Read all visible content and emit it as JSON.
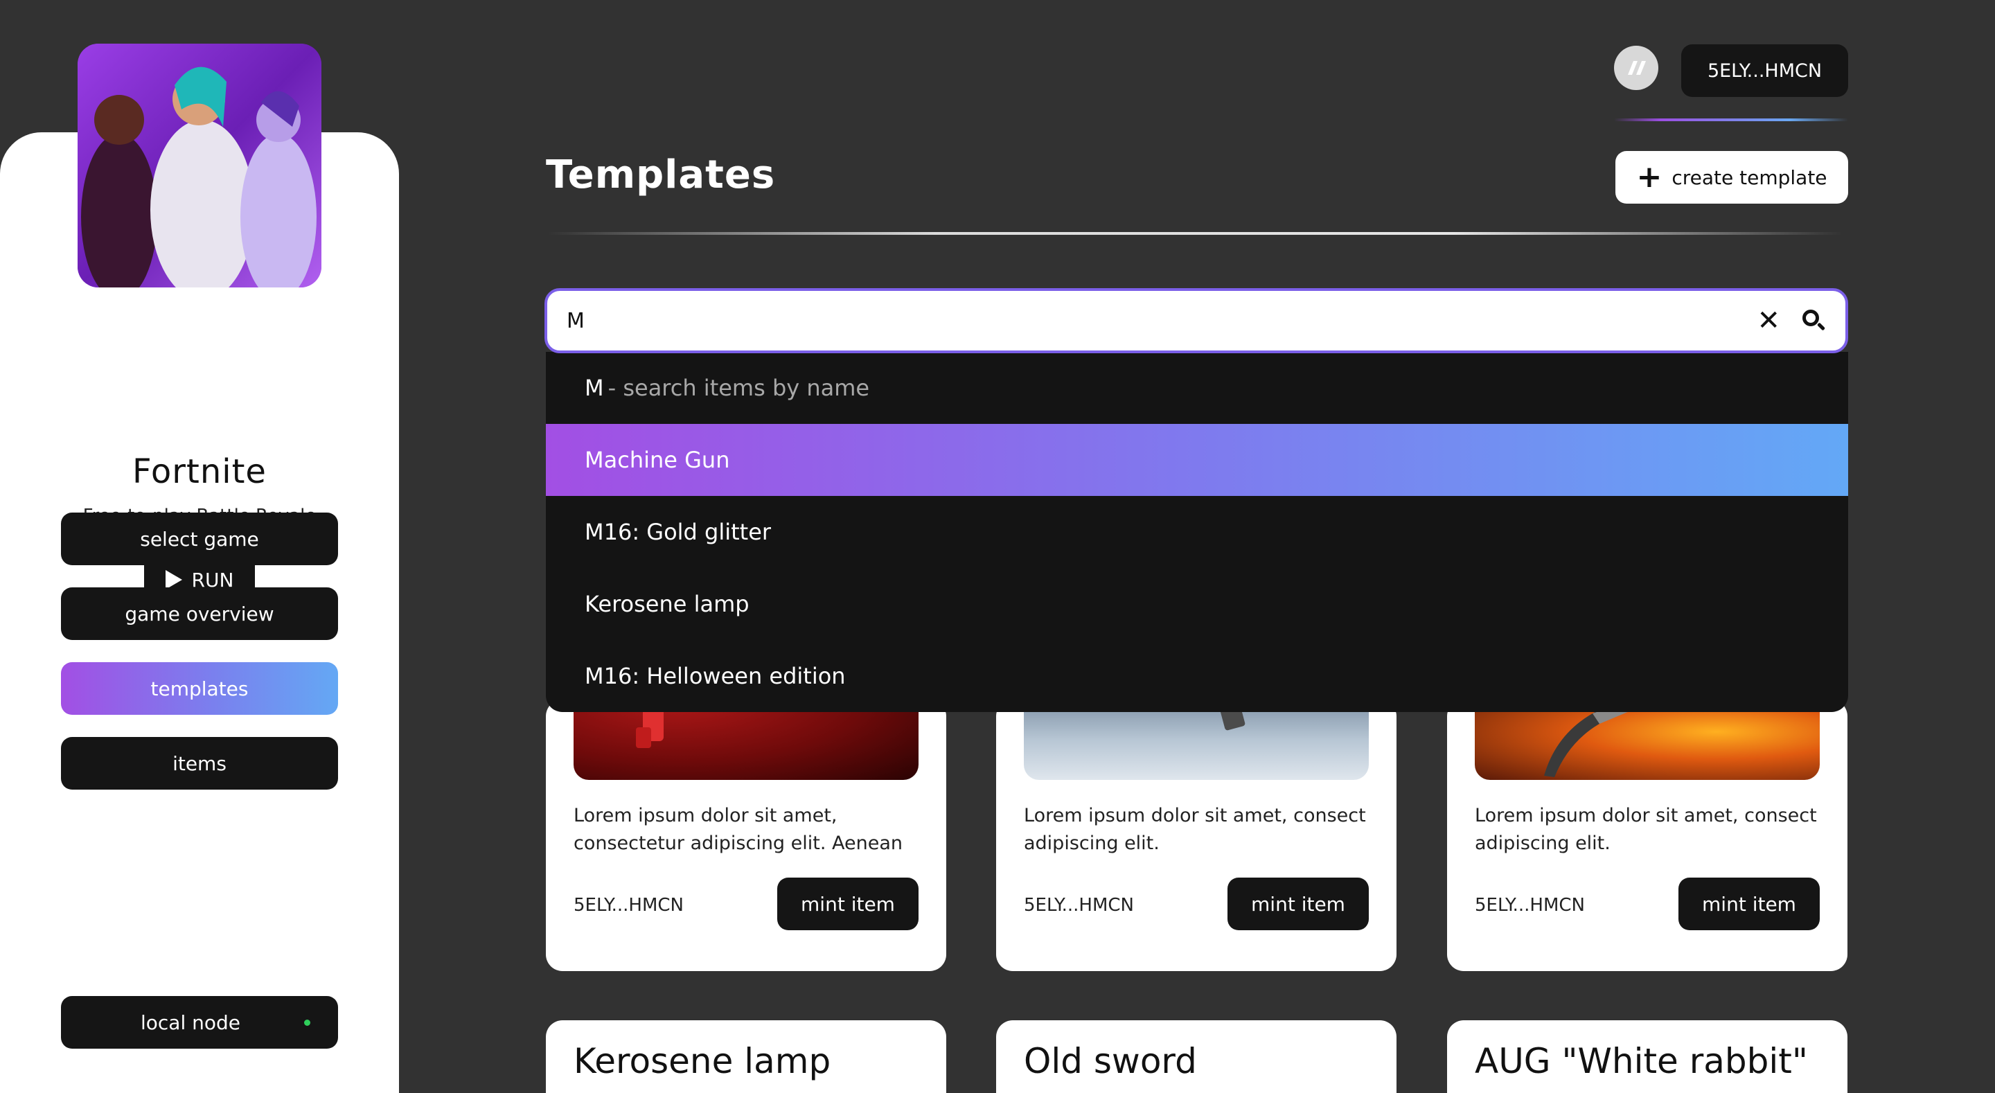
{
  "sidebar": {
    "game": {
      "title": "Fortnite",
      "subtitle": "Free-to-play Battle Royale",
      "run_label": "RUN"
    },
    "nav": [
      {
        "label": "select game",
        "active": false
      },
      {
        "label": "game overview",
        "active": false
      },
      {
        "label": "templates",
        "active": true
      },
      {
        "label": "items",
        "active": false
      }
    ],
    "node": {
      "label": "local node",
      "status_color": "#2fcf5b"
    }
  },
  "header": {
    "wallet_label": "5ELY...HMCN",
    "title": "Templates",
    "create_label": "create template"
  },
  "search": {
    "value": "M",
    "hint_query": "M",
    "hint_text": "- search items by name",
    "suggestions": [
      {
        "label": "Machine Gun",
        "selected": true
      },
      {
        "label": "M16: Gold glitter",
        "selected": false
      },
      {
        "label": "Kerosene lamp",
        "selected": false
      },
      {
        "label": "M16: Helloween edition",
        "selected": false
      }
    ]
  },
  "cards": [
    {
      "description": "Lorem ipsum dolor sit amet, consectetur adipiscing elit. Aenean v…",
      "owner": "5ELY...HMCN",
      "mint_label": "mint item"
    },
    {
      "description": "Lorem ipsum dolor sit amet, consect adipiscing elit.",
      "owner": "5ELY...HMCN",
      "mint_label": "mint item"
    },
    {
      "description": "Lorem ipsum dolor sit amet, consect adipiscing elit.",
      "owner": "5ELY...HMCN",
      "mint_label": "mint item"
    }
  ],
  "bottom_cards": [
    {
      "title": "Kerosene lamp"
    },
    {
      "title": "Old sword"
    },
    {
      "title": "AUG \"White rabbit\""
    }
  ],
  "colors": {
    "background": "#323232",
    "accent_start": "#a24fe4",
    "accent_end": "#64a8f4",
    "search_border": "#7b5fe8"
  }
}
